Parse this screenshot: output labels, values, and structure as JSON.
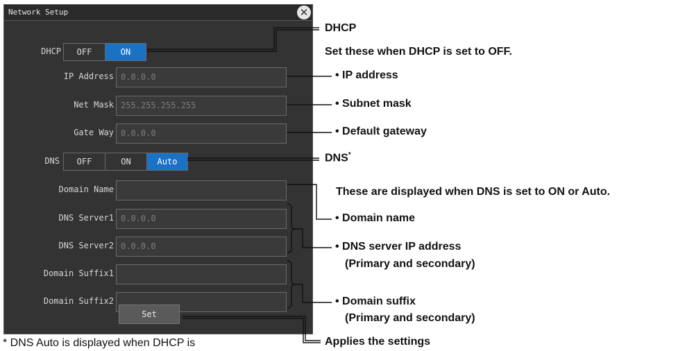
{
  "window": {
    "title": "Network Setup",
    "close_glyph": "✕"
  },
  "dhcp": {
    "label": "DHCP",
    "options": [
      "OFF",
      "ON"
    ],
    "selected": "ON"
  },
  "fields": [
    {
      "label": "IP Address",
      "value": "0.0.0.0"
    },
    {
      "label": "Net Mask",
      "value": "255.255.255.255"
    },
    {
      "label": "Gate Way",
      "value": "0.0.0.0"
    }
  ],
  "dns": {
    "label": "DNS",
    "options": [
      "OFF",
      "ON",
      "Auto"
    ],
    "selected": "Auto"
  },
  "dns_fields": [
    {
      "label": "Domain Name",
      "value": ""
    },
    {
      "label": "DNS Server1",
      "value": "0.0.0.0"
    },
    {
      "label": "DNS Server2",
      "value": "0.0.0.0"
    },
    {
      "label": "Domain Suffix1",
      "value": ""
    },
    {
      "label": "Domain Suffix2",
      "value": ""
    }
  ],
  "set_button": "Set",
  "callouts": {
    "dhcp": "DHCP",
    "dhcp_note": "Set these when DHCP is set to OFF.",
    "ip": "• IP address",
    "mask": "• Subnet mask",
    "gateway": "• Default gateway",
    "dns": "DNS",
    "dns_mark": "*",
    "dns_note": "These are displayed when DNS is set to ON or Auto.",
    "domain_name": "• Domain name",
    "dns_server_1": "• DNS server IP address",
    "dns_server_2": "(Primary and secondary)",
    "suffix_1": "• Domain suffix",
    "suffix_2": "(Primary and secondary)",
    "apply": "Applies the settings"
  },
  "footnote": "* DNS Auto is displayed when DHCP is",
  "colors": {
    "selected": "#1a72c5",
    "panel": "#333333"
  }
}
